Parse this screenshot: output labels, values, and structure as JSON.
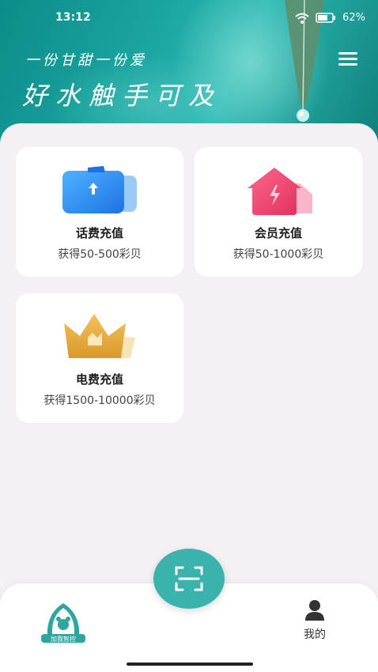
{
  "status": {
    "time": "13:12",
    "battery": "62%"
  },
  "header": {
    "slogan_small": "一份甘甜一份爱",
    "slogan_big": "好水触手可及"
  },
  "cards": [
    {
      "title": "话费充值",
      "subtitle": "获得50-500彩贝",
      "icon": "phone-card-icon",
      "color": "#2a8ef0"
    },
    {
      "title": "会员充值",
      "subtitle": "获得50-1000彩贝",
      "icon": "member-house-icon",
      "color": "#f0406e"
    },
    {
      "title": "电费充值",
      "subtitle": "获得1500-10000彩贝",
      "icon": "crown-icon",
      "color": "#e8a93a"
    }
  ],
  "nav": {
    "home_logo_text": "加我智控",
    "mine_label": "我的"
  },
  "colors": {
    "accent": "#3bb3ad",
    "header": "#1aa39e"
  }
}
